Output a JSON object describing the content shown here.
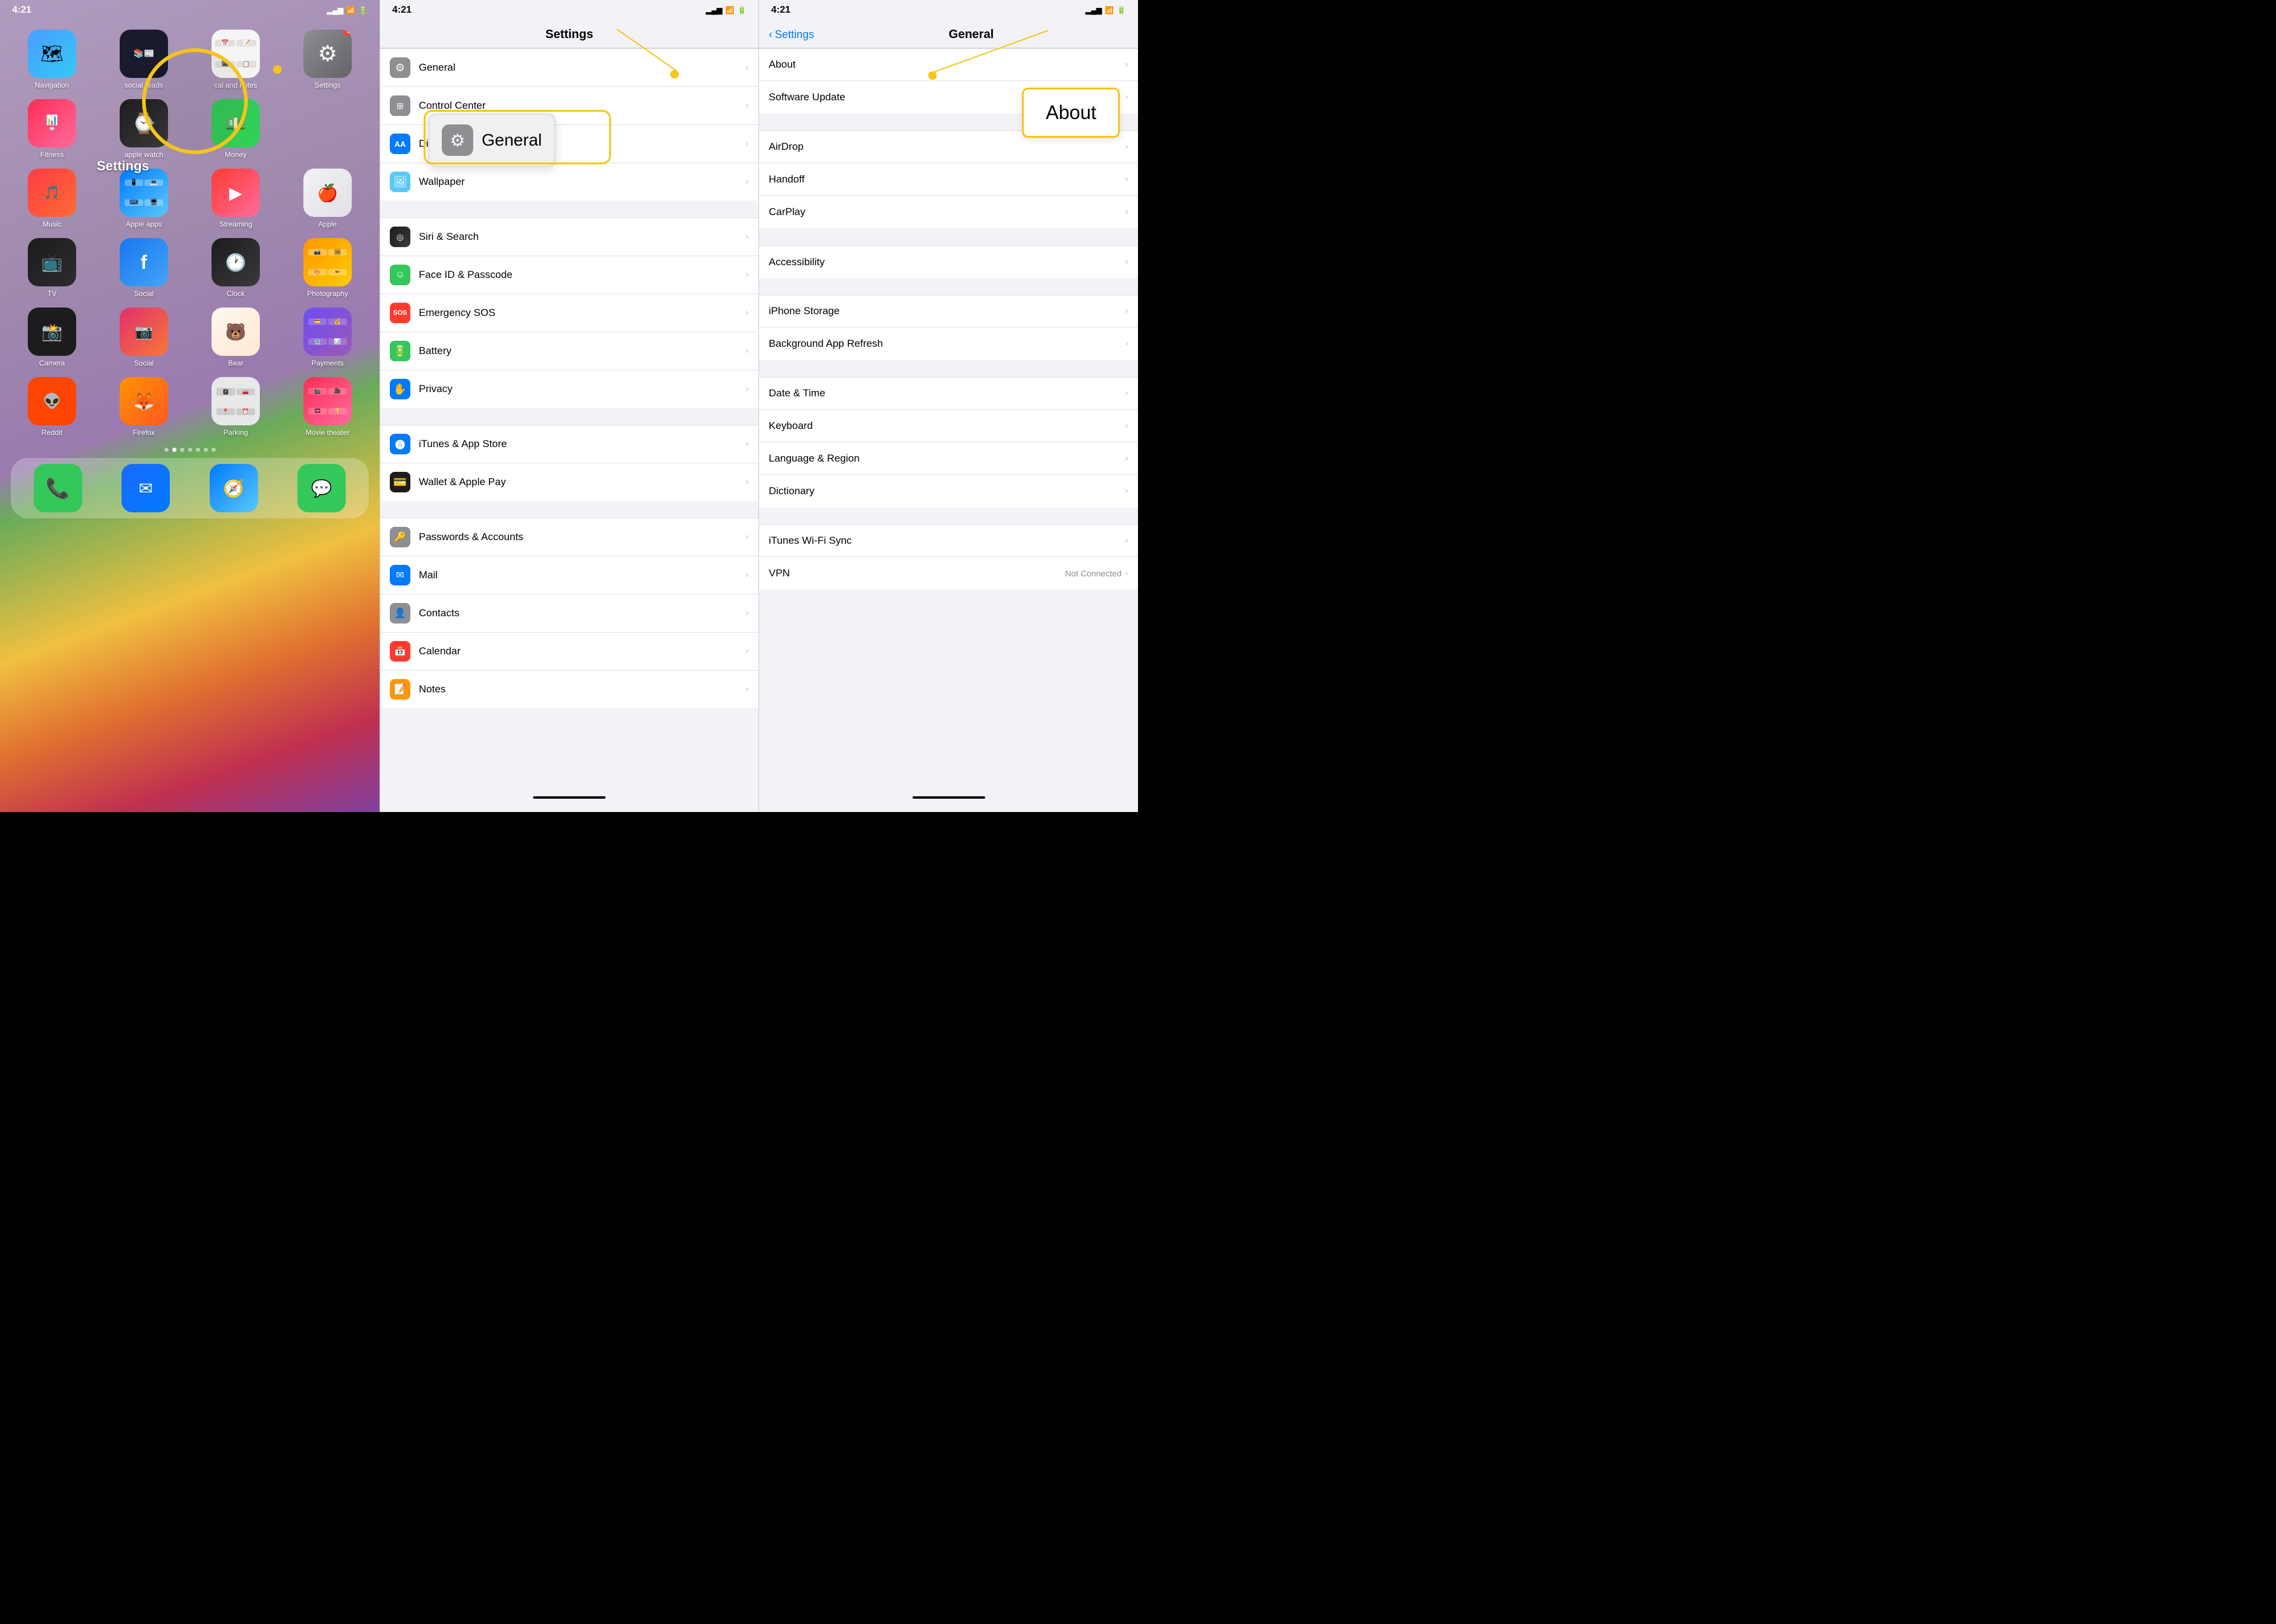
{
  "phone1": {
    "status": {
      "time": "4:21",
      "signal": "▂▄▆",
      "wifi": "WiFi",
      "battery": "Battery"
    },
    "apps": [
      {
        "id": "navigation",
        "label": "Navigation",
        "icon": "🗺",
        "bg": "maps-icon",
        "badge": null
      },
      {
        "id": "social-reads",
        "label": "social reads",
        "icon": "📚",
        "bg": "social-reads-icon",
        "badge": null
      },
      {
        "id": "cal-notes",
        "label": "cal and notes",
        "icon": "📅",
        "bg": "cal-notes-icon",
        "badge": null
      },
      {
        "id": "settings",
        "label": "Settings",
        "icon": "⚙",
        "bg": "settings-icon",
        "badge": "5"
      },
      {
        "id": "fitness",
        "label": "Fitness",
        "icon": "❤",
        "bg": "fitness-icon",
        "badge": null
      },
      {
        "id": "apple-watch",
        "label": "apple watch",
        "icon": "⌚",
        "bg": "apple-watch-icon",
        "badge": null
      },
      {
        "id": "money",
        "label": "Money",
        "icon": "💵",
        "bg": "money-icon",
        "badge": null
      },
      {
        "id": "music",
        "label": "Music",
        "icon": "🎵",
        "bg": "music-icon",
        "badge": null
      },
      {
        "id": "apple-apps",
        "label": "Apple apps",
        "icon": "📱",
        "bg": "apple-apps-icon",
        "badge": null
      },
      {
        "id": "streaming",
        "label": "Streaming",
        "icon": "▶",
        "bg": "streaming-icon",
        "badge": null
      },
      {
        "id": "apple",
        "label": "Apple",
        "icon": "",
        "bg": "apple-icon",
        "badge": null
      },
      {
        "id": "tv",
        "label": "TV",
        "icon": "📺",
        "bg": "tv-icon",
        "badge": null
      },
      {
        "id": "social3",
        "label": "Social",
        "icon": "f",
        "bg": "social-icon",
        "badge": null
      },
      {
        "id": "clock",
        "label": "Clock",
        "icon": "🕐",
        "bg": "clock-icon",
        "badge": null
      },
      {
        "id": "photography",
        "label": "Photography",
        "icon": "📷",
        "bg": "photography-icon",
        "badge": null
      },
      {
        "id": "camera",
        "label": "Camera",
        "icon": "📸",
        "bg": "camera-icon",
        "badge": null
      },
      {
        "id": "social2",
        "label": "Social",
        "icon": "📷",
        "bg": "social2-icon",
        "badge": null
      },
      {
        "id": "bear",
        "label": "Bear",
        "icon": "🐻",
        "bg": "bear-icon",
        "badge": null
      },
      {
        "id": "payments",
        "label": "Payments",
        "icon": "💳",
        "bg": "payments-icon",
        "badge": null
      },
      {
        "id": "reddit",
        "label": "Reddit",
        "icon": "👽",
        "bg": "reddit-icon",
        "badge": null
      },
      {
        "id": "firefox",
        "label": "Firefox",
        "icon": "🦊",
        "bg": "firefox-icon",
        "badge": null
      },
      {
        "id": "parking",
        "label": "Parking",
        "icon": "🅿",
        "bg": "parking-icon",
        "badge": null
      },
      {
        "id": "movietheater",
        "label": "Movie theater",
        "icon": "🎬",
        "bg": "movietheater-icon",
        "badge": null
      }
    ],
    "dock": [
      {
        "id": "phone",
        "label": "Phone",
        "icon": "📞",
        "bg": "phone-icon"
      },
      {
        "id": "mail",
        "label": "Mail",
        "icon": "✉",
        "bg": "mail-icon"
      },
      {
        "id": "safari",
        "label": "Safari",
        "icon": "🧭",
        "bg": "safari-icon"
      },
      {
        "id": "messages",
        "label": "Messages",
        "icon": "💬",
        "bg": "messages-icon"
      }
    ],
    "settings_label": "Settings"
  },
  "phone2": {
    "status": {
      "time": "4:21"
    },
    "title": "Settings",
    "items": [
      {
        "id": "general",
        "label": "General",
        "icon": "⚙",
        "bg": "bg-gray"
      },
      {
        "id": "control-center",
        "label": "Control Center",
        "icon": "⊞",
        "bg": "bg-gray"
      },
      {
        "id": "display",
        "label": "Display & Brightness",
        "icon": "AA",
        "bg": "bg-blue"
      },
      {
        "id": "wallpaper",
        "label": "Wallpaper",
        "icon": "🌄",
        "bg": "bg-teal"
      },
      {
        "id": "siri",
        "label": "Siri & Search",
        "icon": "◎",
        "bg": "bg-dark-gray"
      },
      {
        "id": "faceid",
        "label": "Face ID & Passcode",
        "icon": "☺",
        "bg": "bg-green"
      },
      {
        "id": "sos",
        "label": "Emergency SOS",
        "icon": "SOS",
        "bg": "bg-red"
      },
      {
        "id": "battery",
        "label": "Battery",
        "icon": "🔋",
        "bg": "bg-green"
      },
      {
        "id": "privacy",
        "label": "Privacy",
        "icon": "✋",
        "bg": "bg-blue"
      },
      {
        "id": "itunes",
        "label": "iTunes & App Store",
        "icon": "🅐",
        "bg": "bg-blue"
      },
      {
        "id": "wallet",
        "label": "Wallet & Apple Pay",
        "icon": "💳",
        "bg": "bg-dark-gray"
      },
      {
        "id": "passwords",
        "label": "Passwords & Accounts",
        "icon": "🔑",
        "bg": "bg-gray"
      },
      {
        "id": "mail",
        "label": "Mail",
        "icon": "✉",
        "bg": "bg-blue"
      },
      {
        "id": "contacts",
        "label": "Contacts",
        "icon": "👤",
        "bg": "bg-gray"
      },
      {
        "id": "calendar",
        "label": "Calendar",
        "icon": "📅",
        "bg": "bg-red"
      },
      {
        "id": "notes",
        "label": "Notes",
        "icon": "📝",
        "bg": "bg-orange"
      }
    ],
    "callout_label": "General"
  },
  "phone3": {
    "status": {
      "time": "4:21"
    },
    "back_label": "Settings",
    "title": "General",
    "items": [
      {
        "id": "about",
        "label": "About",
        "group": 1
      },
      {
        "id": "software-update",
        "label": "Software Update",
        "group": 1
      },
      {
        "id": "airdrop",
        "label": "AirDrop",
        "group": 2
      },
      {
        "id": "handoff",
        "label": "Handoff",
        "group": 2
      },
      {
        "id": "carplay",
        "label": "CarPlay",
        "group": 2
      },
      {
        "id": "accessibility",
        "label": "Accessibility",
        "group": 3
      },
      {
        "id": "iphone-storage",
        "label": "iPhone Storage",
        "group": 4
      },
      {
        "id": "background-refresh",
        "label": "Background App Refresh",
        "group": 4
      },
      {
        "id": "date-time",
        "label": "Date & Time",
        "group": 5
      },
      {
        "id": "keyboard",
        "label": "Keyboard",
        "group": 5
      },
      {
        "id": "language-region",
        "label": "Language & Region",
        "group": 5
      },
      {
        "id": "dictionary",
        "label": "Dictionary",
        "group": 5
      },
      {
        "id": "itunes-wifi",
        "label": "iTunes Wi-Fi Sync",
        "group": 6
      },
      {
        "id": "vpn",
        "label": "VPN",
        "value": "Not Connected",
        "group": 6
      }
    ],
    "about_callout": "About"
  },
  "annotations": {
    "dot_color": "#f5c518",
    "line_color": "#f5c518",
    "box_color": "#f5c518"
  }
}
